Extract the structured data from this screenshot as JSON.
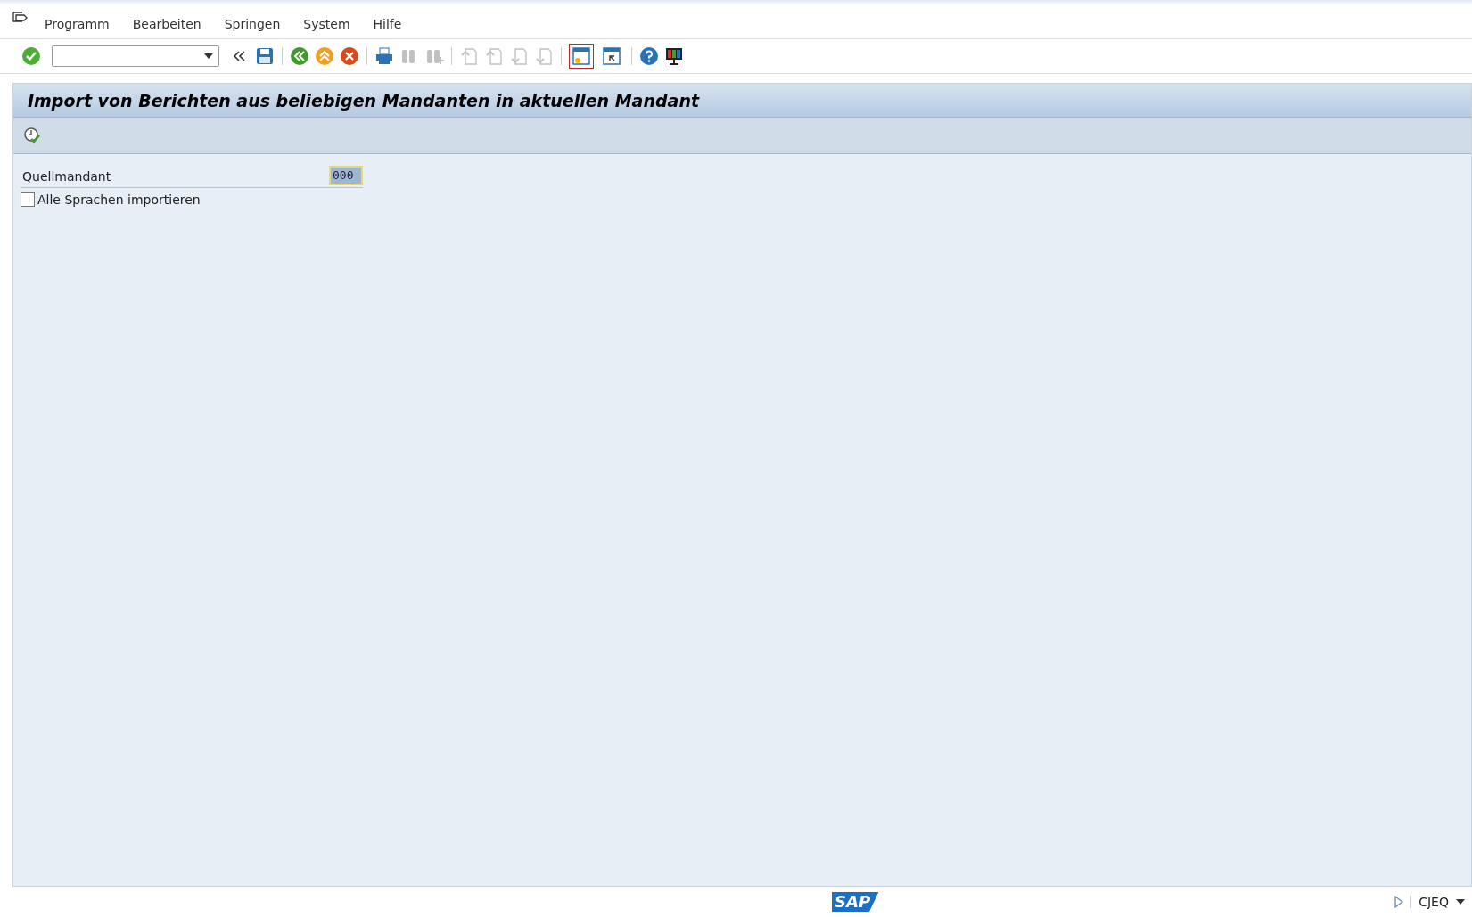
{
  "menu_bar": {
    "items": [
      {
        "label": "Programm"
      },
      {
        "label": "Bearbeiten"
      },
      {
        "label": "Springen"
      },
      {
        "label": "System"
      },
      {
        "label": "Hilfe"
      }
    ]
  },
  "toolbar": {
    "items": [
      {
        "kind": "enter",
        "disabled": false
      },
      {
        "kind": "command"
      },
      {
        "kind": "collapse",
        "disabled": false
      },
      {
        "kind": "save",
        "disabled": false
      },
      {
        "kind": "sep"
      },
      {
        "kind": "back",
        "disabled": false
      },
      {
        "kind": "exit",
        "disabled": false
      },
      {
        "kind": "cancel",
        "disabled": false
      },
      {
        "kind": "sep"
      },
      {
        "kind": "print",
        "disabled": false
      },
      {
        "kind": "find",
        "disabled": true
      },
      {
        "kind": "findnext",
        "disabled": true
      },
      {
        "kind": "sep"
      },
      {
        "kind": "first",
        "disabled": true
      },
      {
        "kind": "prev",
        "disabled": true
      },
      {
        "kind": "next",
        "disabled": true
      },
      {
        "kind": "last",
        "disabled": true
      },
      {
        "kind": "sep"
      },
      {
        "kind": "newsession",
        "disabled": false,
        "selected": true
      },
      {
        "kind": "shortcut",
        "disabled": false,
        "selected": false
      },
      {
        "kind": "sep"
      },
      {
        "kind": "help",
        "disabled": false
      },
      {
        "kind": "layout",
        "disabled": false
      }
    ]
  },
  "title": "Import von Berichten aus beliebigen Mandanten in aktuellen Mandant",
  "app_toolbar": {
    "items": [
      {
        "kind": "execute"
      }
    ]
  },
  "form": {
    "fields": [
      {
        "kind": "input",
        "label": "Quellmandant",
        "value": "000"
      },
      {
        "kind": "checkbox",
        "label": "Alle Sprachen importieren",
        "checked": false
      }
    ]
  },
  "status_bar": {
    "logo": "SAP",
    "system": "CJEQ"
  }
}
